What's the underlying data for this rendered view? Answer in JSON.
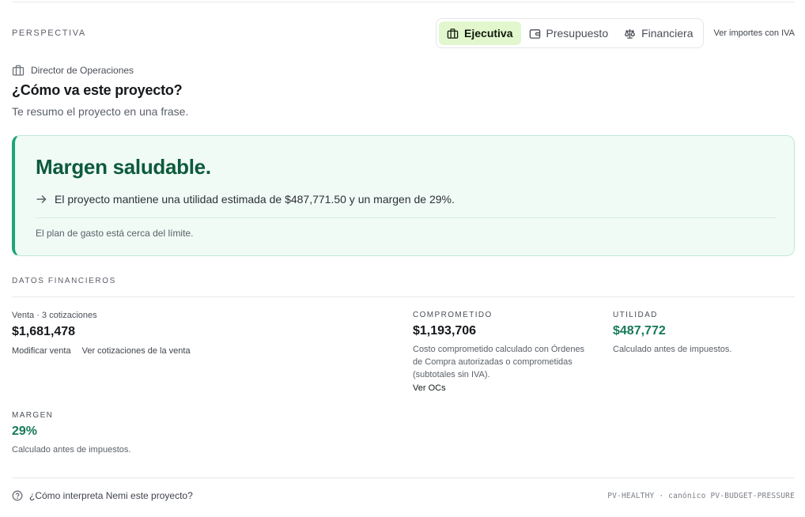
{
  "perspective": {
    "label": "PERSPECTIVA",
    "tabs": [
      {
        "label": "Ejecutiva",
        "icon": "briefcase-icon",
        "active": true
      },
      {
        "label": "Presupuesto",
        "icon": "wallet-icon",
        "active": false
      },
      {
        "label": "Financiera",
        "icon": "scale-icon",
        "active": false
      }
    ],
    "iva_link": "Ver importes con IVA"
  },
  "summary": {
    "role": "Director de Operaciones",
    "question": "¿Cómo va este proyecto?",
    "subtitle": "Te resumo el proyecto en una frase."
  },
  "status_card": {
    "headline": "Margen saludable.",
    "detail": "El proyecto mantiene una utilidad estimada de $487,771.50 y un margen de 29%.",
    "note": "El plan de gasto está cerca del límite.",
    "accent_color": "#1fa37a"
  },
  "financial": {
    "section_label": "DATOS FINANCIEROS",
    "venta": {
      "label": "Venta · 3 cotizaciones",
      "value": "$1,681,478",
      "link_modify": "Modificar venta",
      "link_quotes": "Ver cotizaciones de la venta"
    },
    "comprometido": {
      "label": "COMPROMETIDO",
      "value": "$1,193,706",
      "desc": "Costo comprometido calculado con Órdenes de Compra autorizadas o comprometidas (subtotales sin IVA).",
      "link": "Ver OCs"
    },
    "utilidad": {
      "label": "UTILIDAD",
      "value": "$487,772",
      "desc": "Calculado antes de impuestos."
    },
    "margen": {
      "label": "MARGEN",
      "value": "29%",
      "desc": "Calculado antes de impuestos."
    }
  },
  "footer": {
    "help": "¿Cómo interpreta Nemi este proyecto?",
    "codes": "PV-HEALTHY · canónico PV-BUDGET-PRESSURE"
  }
}
